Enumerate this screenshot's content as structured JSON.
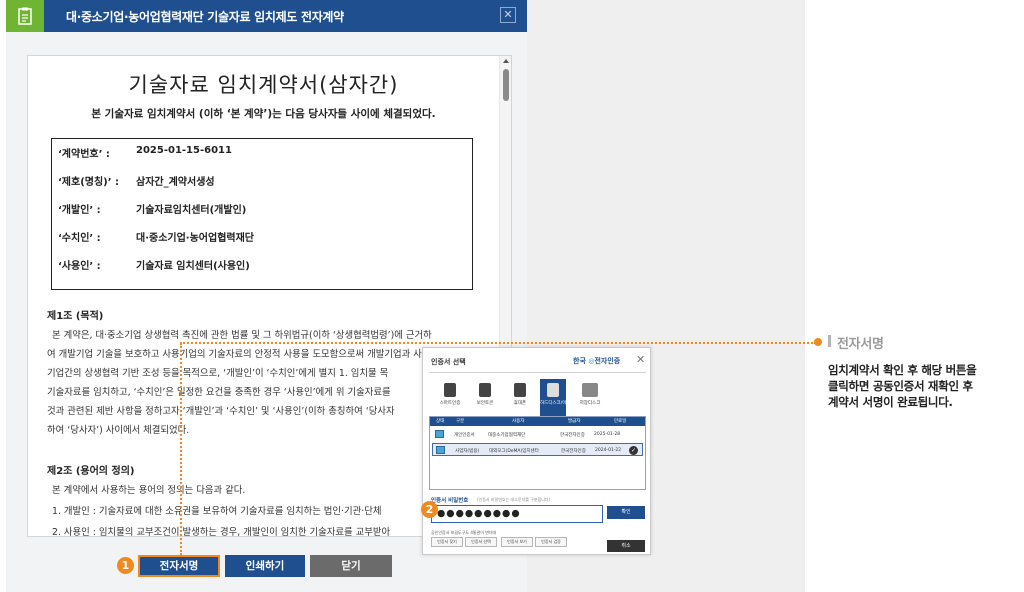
{
  "window": {
    "title": "대·중소기업·농어업협력재단 기술자료 임치제도 전자계약",
    "close_glyph": "✕"
  },
  "document": {
    "title": "기술자료 임치계약서(삼자간)",
    "subtitle": "본 기술자료 임치계약서 (이하 ‘본 계약’)는 다음 당사자들 사이에 체결되었다.",
    "info": [
      {
        "key": "‘계약번호’ :",
        "value": "2025-01-15-6011"
      },
      {
        "key": "‘제호(명칭)’ :",
        "value": "삼자간_계약서생성"
      },
      {
        "key": "‘개발인’ :",
        "value": "기술자료임치센터(개발인)"
      },
      {
        "key": "‘수치인’ :",
        "value": "대·중소기업·농어업협력재단"
      },
      {
        "key": "‘사용인’ :",
        "value": "기술자료 임치센터(사용인)"
      }
    ],
    "article1": {
      "title": "제1조 (목적)",
      "lines": [
        "본 계약은, 대·중소기업 상생협력 촉진에 관한 법률 및 그 하위법규(이하 ‘상생협력법령’)에 근거하",
        "여 개발기업 기술을 보호하고 사용기업의 기술자료의 안정적 사용을 도모함으로써 개발기업과 사용",
        "기업간의 상생협력 기반 조성 등을 목적으로, ‘개발인’이 ‘수치인’에게 별지 1. 임치물 목",
        "기술자료를 임치하고, ‘수치인’은 일정한 요건을 충족한 경우 ‘사용인’에게 위 기술자료를",
        "것과 관련된 제반 사항을 정하고자 ‘개발인’과 ‘수치인’ 및 ‘사용인’(이하 총칭하여 ‘당사자",
        "하여 ‘당사자’) 사이에서 체결되었다."
      ]
    },
    "article2": {
      "title": "제2조 (용어의 정의)",
      "lines": [
        "본 계약에서 사용하는 용어의 정의는 다음과 같다.",
        "1. 개발인 : 기술자료에 대한 소유권을 보유하여 기술자료를 임치하는 법인·기관·단체",
        "2. 사용인 : 임치물의 교부조건이 발생하는 경우, 개발인이 임치한 기술자료를 교부받아"
      ]
    }
  },
  "buttons": {
    "sign": "전자서명",
    "print": "인쇄하기",
    "close": "닫기"
  },
  "badges": {
    "one": "1",
    "two": "2"
  },
  "cert_dialog": {
    "title": "인증서 선택",
    "brand_pre": "한국",
    "brand_post": "전자인증",
    "close_glyph": "✕",
    "media": [
      "스마트인증",
      "보안토큰",
      "휴대폰",
      "하드디스크/이동식",
      "저장디스크"
    ],
    "table_headers": [
      "상태",
      "구분",
      "사용자",
      "발급자",
      "만료일"
    ],
    "rows": [
      {
        "type": "개인인증서",
        "user": "대중소기업협력재단",
        "issuer": "한국전자인증",
        "expiry": "2025-01-28"
      },
      {
        "type": "사업자(범용)",
        "user": "대외모그(DeMA)임치센터",
        "issuer": "한국전자인증",
        "expiry": "2024-01-22"
      }
    ],
    "pw_label": "인증서 비밀번호",
    "pw_hint": "(인증서 비밀번호는 대소문자를 구분합니다)",
    "pw_value": "●●●●●●●●●",
    "ok_label": "확인",
    "foot_text": "공인인증서 보길도구도 4통관이 변더대",
    "small_buttons": [
      "인증서 찾기",
      "인증서 선택",
      "인증서 보기",
      "인증서 검증"
    ],
    "cancel_label": "취소"
  },
  "annotation": {
    "title": "전자서명",
    "lines": [
      "임치계약서 확인 후 해당 버튼을",
      "클릭하면 공동인증서 재확인 후",
      "계약서 서명이 완료됩니다."
    ]
  },
  "colors": {
    "titlebar": "#1f4f8e",
    "title_icon": "#6fb533",
    "accent_orange": "#f08a1e",
    "close_button": "#6b6b6b"
  }
}
